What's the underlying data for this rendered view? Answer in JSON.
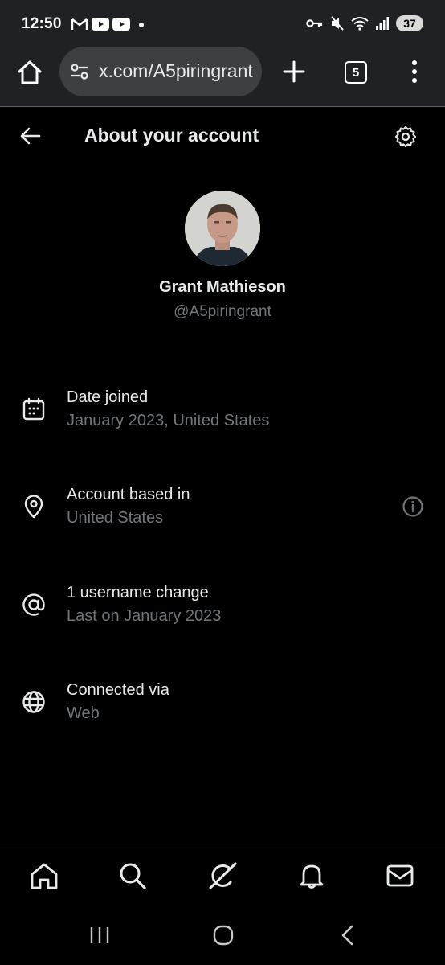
{
  "status_bar": {
    "time": "12:50",
    "battery": "37",
    "left_icons": [
      "gmail-icon",
      "youtube-icon",
      "youtube-icon",
      "dot-icon"
    ],
    "right_icons": [
      "key-icon",
      "mute-icon",
      "wifi-icon",
      "signal-icon"
    ]
  },
  "browser": {
    "url": "x.com/A5piringrant",
    "tab_count": "5"
  },
  "header": {
    "title": "About your account"
  },
  "profile": {
    "name": "Grant Mathieson",
    "handle": "@A5piringrant"
  },
  "info_rows": [
    {
      "icon": "calendar-icon",
      "title": "Date joined",
      "subtitle": "January 2023, United States"
    },
    {
      "icon": "location-pin-icon",
      "title": "Account based in",
      "subtitle": "United States",
      "has_info": true
    },
    {
      "icon": "at-sign-icon",
      "title": "1 username change",
      "subtitle": "Last on January 2023"
    },
    {
      "icon": "globe-icon",
      "title": "Connected via",
      "subtitle": "Web"
    }
  ],
  "bottom_nav": [
    "home-icon",
    "search-icon",
    "grok-icon",
    "bell-icon",
    "mail-icon"
  ],
  "android_nav": [
    "recents-icon",
    "home-circle-icon",
    "back-chevron-icon"
  ],
  "colors": {
    "background": "#000000",
    "primary_text": "#e7e9ea",
    "secondary_text": "#71767b",
    "browser_chrome": "#202124"
  }
}
